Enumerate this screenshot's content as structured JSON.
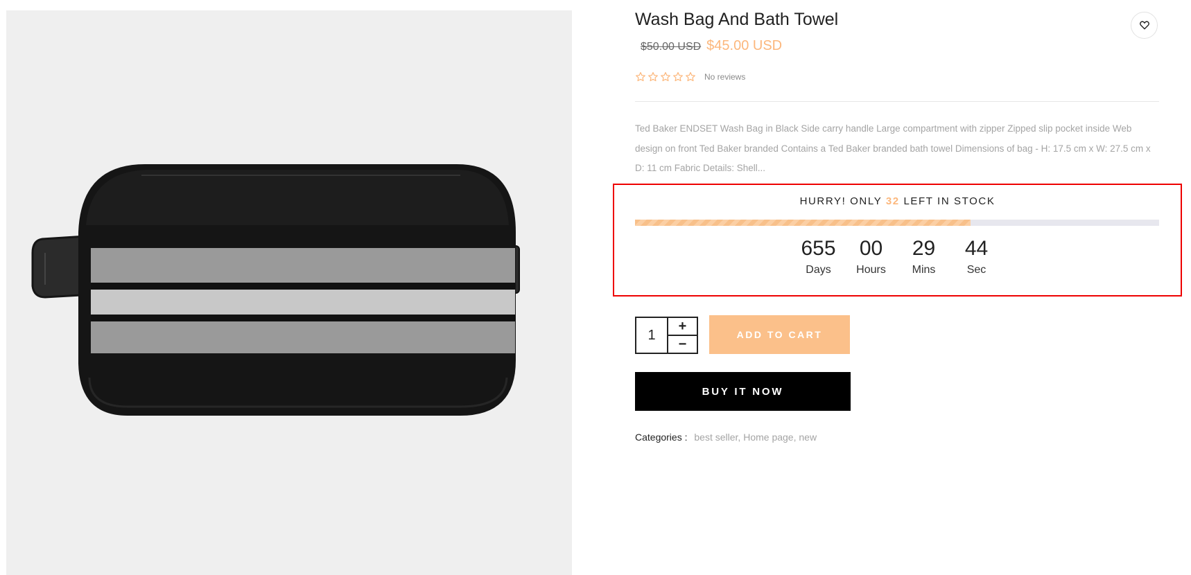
{
  "product": {
    "title": "Wash Bag And Bath Towel",
    "old_price": "$50.00 USD",
    "new_price": "$45.00 USD",
    "rating": 0,
    "reviews_text": "No reviews",
    "description": "Ted Baker ENDSET Wash Bag in Black Side carry handle Large compartment with zipper Zipped slip pocket inside Web design on front Ted Baker branded Contains a Ted Baker branded bath towel Dimensions of bag - H: 17.5 cm x W: 27.5 cm x D: 11 cm Fabric Details: Shell..."
  },
  "stock": {
    "prefix": "HURRY! ONLY",
    "count": "32",
    "suffix": "LEFT IN STOCK",
    "level_fraction": 0.64
  },
  "countdown": [
    {
      "value": "655",
      "label": "Days"
    },
    {
      "value": "00",
      "label": "Hours"
    },
    {
      "value": "29",
      "label": "Mins"
    },
    {
      "value": "44",
      "label": "Sec"
    }
  ],
  "cart": {
    "quantity": "1",
    "plus": "+",
    "minus": "−",
    "add_to_cart_label": "ADD TO CART",
    "buy_now_label": "BUY IT NOW"
  },
  "categories": {
    "label": "Categories :",
    "items": [
      "best seller",
      "Home page",
      "new"
    ]
  },
  "colors": {
    "accent": "#fcb77c",
    "button_dark": "#000000",
    "highlight_border": "#ee0000"
  }
}
